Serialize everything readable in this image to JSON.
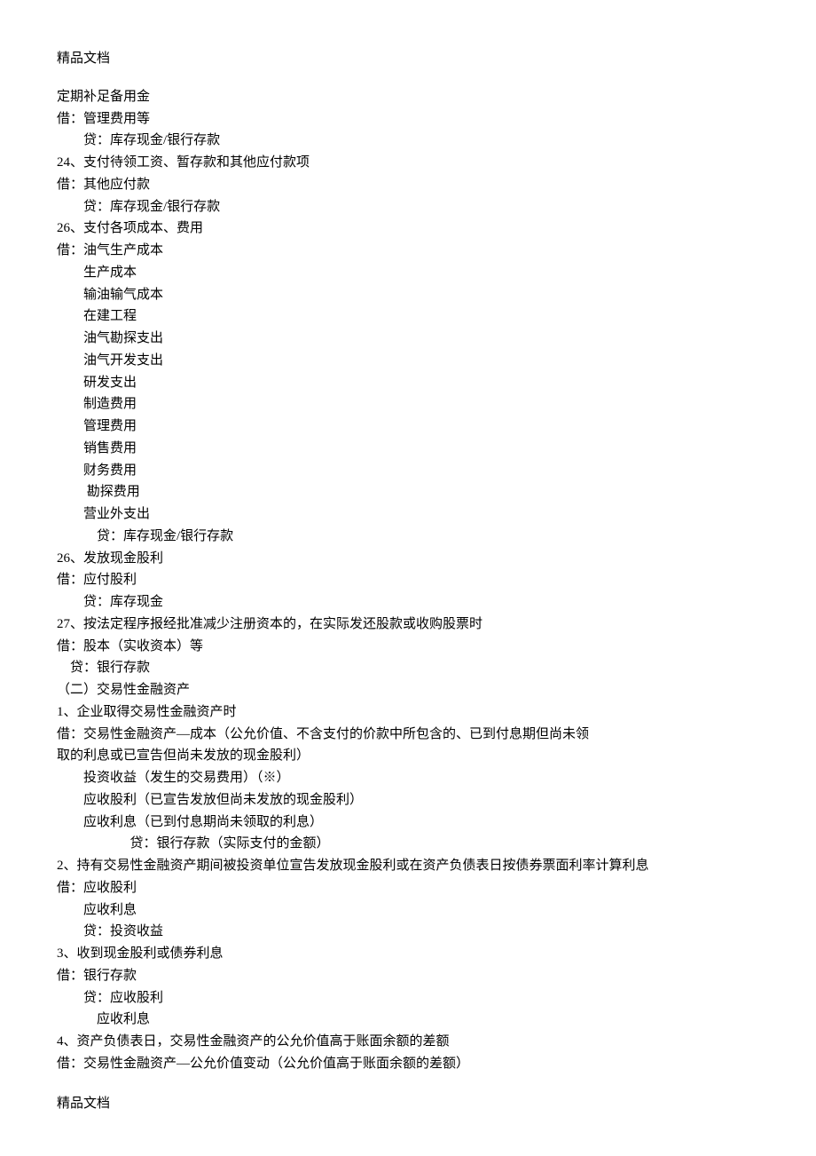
{
  "header": "精品文档",
  "footer": "精品文档",
  "lines": [
    {
      "cls": "",
      "t": "定期补足备用金"
    },
    {
      "cls": "",
      "t": "借：管理费用等"
    },
    {
      "cls": "indent-1",
      "t": "贷：库存现金/银行存款"
    },
    {
      "cls": "",
      "t": "24、支付待领工资、暂存款和其他应付款项"
    },
    {
      "cls": "",
      "t": "借：其他应付款"
    },
    {
      "cls": "indent-1",
      "t": "贷：库存现金/银行存款"
    },
    {
      "cls": "",
      "t": "26、支付各项成本、费用"
    },
    {
      "cls": "",
      "t": "借：油气生产成本"
    },
    {
      "cls": "indent-1",
      "t": "生产成本"
    },
    {
      "cls": "indent-1",
      "t": "输油输气成本"
    },
    {
      "cls": "indent-1",
      "t": "在建工程"
    },
    {
      "cls": "indent-1",
      "t": "油气勘探支出"
    },
    {
      "cls": "indent-1",
      "t": "油气开发支出"
    },
    {
      "cls": "indent-1",
      "t": "研发支出"
    },
    {
      "cls": "indent-1",
      "t": "制造费用"
    },
    {
      "cls": "indent-1",
      "t": "管理费用"
    },
    {
      "cls": "indent-1",
      "t": "销售费用"
    },
    {
      "cls": "indent-1",
      "t": "财务费用"
    },
    {
      "cls": "indent-1",
      "t": " 勘探费用"
    },
    {
      "cls": "indent-1",
      "t": "营业外支出"
    },
    {
      "cls": "indent-2",
      "t": "贷：库存现金/银行存款"
    },
    {
      "cls": "",
      "t": "26、发放现金股利"
    },
    {
      "cls": "",
      "t": "借：应付股利"
    },
    {
      "cls": "indent-1",
      "t": "贷：库存现金"
    },
    {
      "cls": "",
      "t": "27、按法定程序报经批准减少注册资本的，在实际发还股款或收购股票时"
    },
    {
      "cls": "",
      "t": "借：股本（实收资本）等"
    },
    {
      "cls": "",
      "t": "    贷：银行存款"
    },
    {
      "cls": "",
      "t": "（二）交易性金融资产"
    },
    {
      "cls": "",
      "t": "1、企业取得交易性金融资产时"
    },
    {
      "cls": "",
      "t": "借：交易性金融资产—成本（公允价值、不含支付的价款中所包含的、已到付息期但尚未领"
    },
    {
      "cls": "",
      "t": "取的利息或已宣告但尚未发放的现金股利）"
    },
    {
      "cls": "indent-1",
      "t": "投资收益（发生的交易费用）（※）"
    },
    {
      "cls": "indent-1",
      "t": "应收股利（已宣告发放但尚未发放的现金股利）"
    },
    {
      "cls": "indent-1",
      "t": "应收利息（已到付息期尚未领取的利息）"
    },
    {
      "cls": "indent-3",
      "t": "贷：银行存款（实际支付的金额）"
    },
    {
      "cls": "",
      "t": "2、持有交易性金融资产期间被投资单位宣告发放现金股利或在资产负债表日按债券票面利率计算利息"
    },
    {
      "cls": "",
      "t": "借：应收股利"
    },
    {
      "cls": "indent-1",
      "t": "应收利息"
    },
    {
      "cls": "indent-1",
      "t": "贷：投资收益"
    },
    {
      "cls": "",
      "t": "3、收到现金股利或债券利息"
    },
    {
      "cls": "",
      "t": "借：银行存款"
    },
    {
      "cls": "indent-1",
      "t": "贷：应收股利"
    },
    {
      "cls": "indent-2",
      "t": "应收利息"
    },
    {
      "cls": "",
      "t": "4、资产负债表日，交易性金融资产的公允价值高于账面余额的差额"
    },
    {
      "cls": "",
      "t": "借：交易性金融资产—公允价值变动（公允价值高于账面余额的差额）"
    }
  ]
}
